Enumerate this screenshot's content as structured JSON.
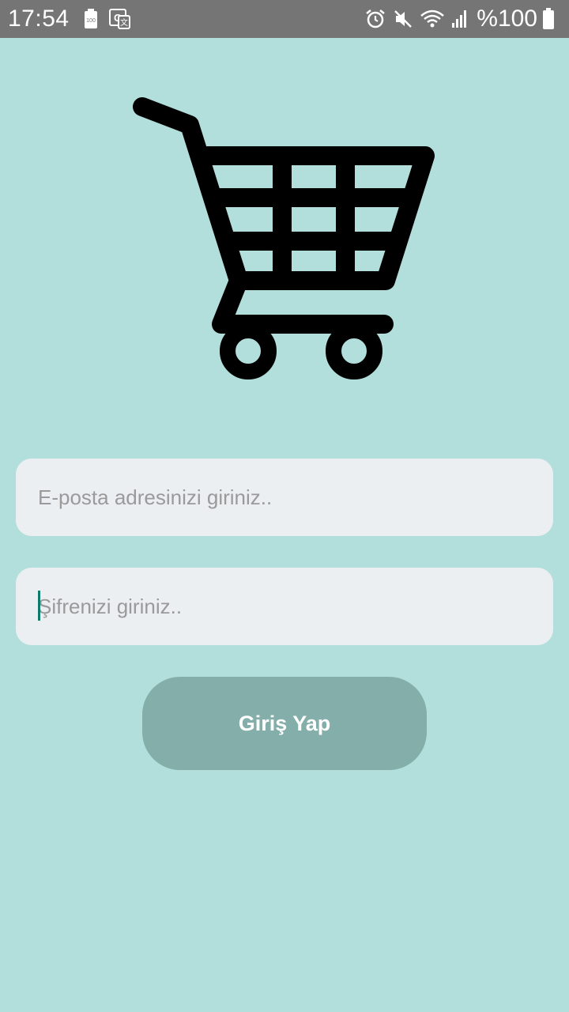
{
  "status_bar": {
    "time": "17:54",
    "battery_text": "%100",
    "icons": [
      "battery-saver-icon",
      "translate-icon",
      "alarm-icon",
      "mute-icon",
      "wifi-icon",
      "signal-icon",
      "battery-icon"
    ]
  },
  "logo": {
    "icon": "shopping-cart-icon"
  },
  "form": {
    "email_placeholder": "E-posta adresinizi giriniz..",
    "password_placeholder": "Şifrenizi giriniz..",
    "login_label": "Giriş Yap"
  },
  "colors": {
    "background": "#b2dfdc",
    "status_bar": "#757575",
    "field_bg": "#eceff2",
    "button_bg": "#84aeaa",
    "cursor": "#0e7a6a"
  }
}
